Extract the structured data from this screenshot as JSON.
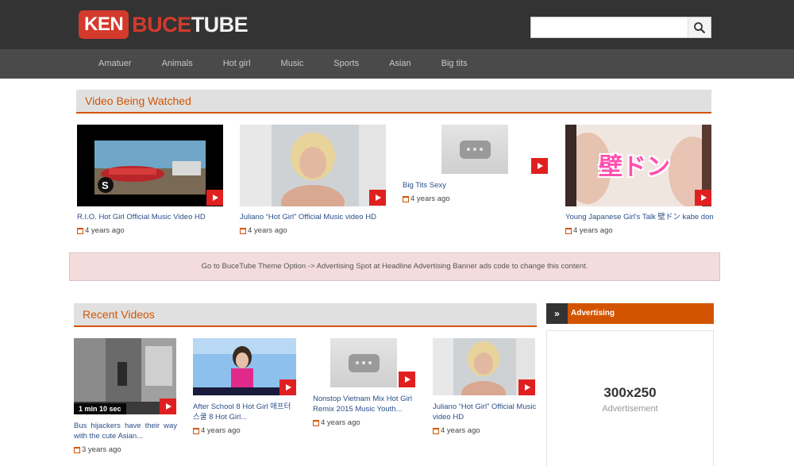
{
  "logo": {
    "part1": "KEN",
    "part2": "BUCE",
    "part3": "TUBE"
  },
  "search": {
    "placeholder": "",
    "button_icon": "search-icon"
  },
  "nav": {
    "items": [
      "Amatuer",
      "Animals",
      "Hot girl",
      "Music",
      "Sports",
      "Asian",
      "Big tits"
    ]
  },
  "watched": {
    "heading": "Video Being Watched",
    "videos": [
      {
        "title": "R.I.O. Hot Girl Official Music Video HD",
        "date": "4 years ago"
      },
      {
        "title": "Juliano “Hot Girl” Official Music video HD",
        "date": "4 years ago"
      },
      {
        "title": "Big Tits Sexy",
        "date": "4 years ago"
      },
      {
        "title": "Young Japanese Girl's Talk 壁ドン kabe don",
        "date": "4 years ago",
        "overlay": "壁ドン"
      }
    ]
  },
  "banner": {
    "text": "Go to BuceTube Theme Option -> Advertising Spot at Headline Advertising Banner ads code to change this content."
  },
  "recent": {
    "heading": "Recent Videos",
    "videos": [
      {
        "title": "Bus hijackers have their way with the cute Asian...",
        "date": "3 years ago",
        "duration": "1 min 10 sec"
      },
      {
        "title": "After School 8 Hot Girl 애프터스쿨 8 Hot Girl...",
        "date": "4 years ago"
      },
      {
        "title": "Nonstop Vietnam Mix Hot Girl Remix 2015 Music Youth...",
        "date": "4 years ago"
      },
      {
        "title": "Juliano “Hot Girl” Official Music video HD",
        "date": "4 years ago"
      }
    ]
  },
  "sidebar": {
    "heading": "Advertising",
    "ad_size": "300x250",
    "ad_label": "Advertisement"
  },
  "colors": {
    "accent": "#d35400",
    "header": "#333333",
    "nav": "#4a4a4a",
    "play": "#e02020",
    "link": "#2a4f8a"
  }
}
